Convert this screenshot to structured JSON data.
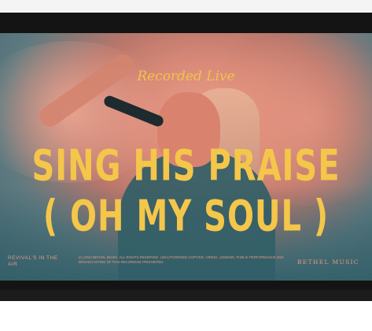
{
  "video": {
    "subtitle": "Recorded Live",
    "title_line1": "SING HIS PRAISE",
    "title_line2": "( OH MY SOUL )",
    "footer_left": "REVIVAL'S IN THE AIR",
    "footer_middle": "(C) 2022 BETHEL MUSIC. ALL RIGHTS RESERVED. UNAUTHORISED COPYING, HIRING, LENDING, PUBLIC PERFORMANCE AND BROADCASTING OF THIS RECORDING PROHIBITED.",
    "footer_right": "BETHEL MUSIC",
    "colors": {
      "title": "#f4c64a",
      "footer": "#e49a7e",
      "duotone_pink": "#d98a78",
      "duotone_teal": "#3f6670"
    }
  }
}
